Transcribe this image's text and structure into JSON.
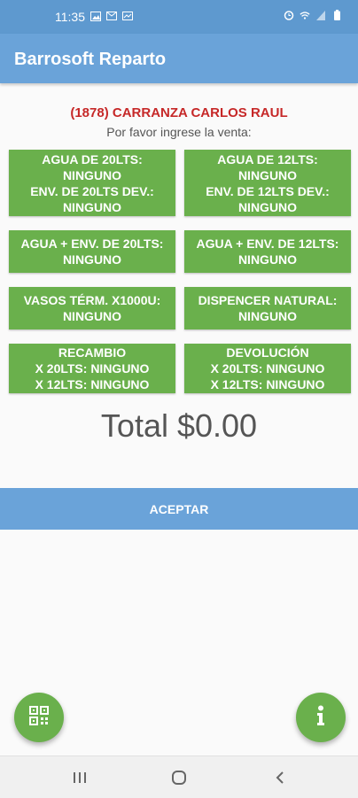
{
  "status_bar": {
    "time": "11:35",
    "icons_left": [
      "gallery-icon",
      "gmail-icon",
      "cast-icon"
    ],
    "icons_right": [
      "alarm-icon",
      "wifi-icon",
      "signal-icon",
      "battery-icon"
    ]
  },
  "app": {
    "title": "Barrosoft Reparto"
  },
  "customer": {
    "name": "(1878) CARRANZA CARLOS RAUL",
    "prompt": "Por favor ingrese la venta:"
  },
  "tiles": [
    {
      "id": "agua-20",
      "lines": [
        "AGUA DE 20LTS:",
        "NINGUNO",
        "ENV. DE 20LTS DEV.:",
        "NINGUNO"
      ]
    },
    {
      "id": "agua-12",
      "lines": [
        "AGUA DE 12LTS:",
        "NINGUNO",
        "ENV. DE 12LTS DEV.:",
        "NINGUNO"
      ]
    },
    {
      "id": "agua-env-20",
      "lines": [
        "AGUA + ENV. DE 20LTS:",
        "NINGUNO"
      ]
    },
    {
      "id": "agua-env-12",
      "lines": [
        "AGUA + ENV. DE 12LTS:",
        "NINGUNO"
      ]
    },
    {
      "id": "vasos-term",
      "lines": [
        "VASOS TÉRM. X1000U:",
        "NINGUNO"
      ]
    },
    {
      "id": "dispencer",
      "lines": [
        "DISPENCER NATURAL:",
        "NINGUNO"
      ]
    },
    {
      "id": "recambio",
      "lines": [
        "RECAMBIO",
        "X 20LTS: NINGUNO",
        "X 12LTS: NINGUNO"
      ]
    },
    {
      "id": "devolucion",
      "lines": [
        "DEVOLUCIÓN",
        "X 20LTS: NINGUNO",
        "X 12LTS: NINGUNO"
      ]
    }
  ],
  "total": "Total $0.00",
  "accept_label": "ACEPTAR",
  "fabs": {
    "left": "qr-code-icon",
    "right": "info-icon"
  },
  "colors": {
    "status_bar": "#5e99cf",
    "app_bar": "#6aa3d9",
    "tile": "#6ab04c",
    "customer_name": "#c62828",
    "accept_button": "#6aa3d9"
  }
}
